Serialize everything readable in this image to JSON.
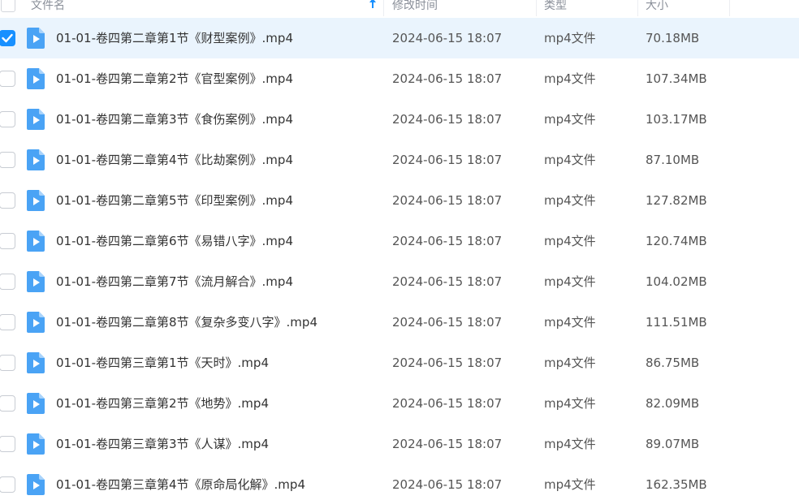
{
  "header": {
    "name_label": "文件名",
    "modified_label": "修改时间",
    "type_label": "类型",
    "size_label": "大小"
  },
  "files": [
    {
      "name": "01-01-卷四第二章第1节《财型案例》.mp4",
      "modified": "2024-06-15 18:07",
      "type": "mp4文件",
      "size": "70.18MB",
      "selected": true
    },
    {
      "name": "01-01-卷四第二章第2节《官型案例》.mp4",
      "modified": "2024-06-15 18:07",
      "type": "mp4文件",
      "size": "107.34MB",
      "selected": false
    },
    {
      "name": "01-01-卷四第二章第3节《食伤案例》.mp4",
      "modified": "2024-06-15 18:07",
      "type": "mp4文件",
      "size": "103.17MB",
      "selected": false
    },
    {
      "name": "01-01-卷四第二章第4节《比劫案例》.mp4",
      "modified": "2024-06-15 18:07",
      "type": "mp4文件",
      "size": "87.10MB",
      "selected": false
    },
    {
      "name": "01-01-卷四第二章第5节《印型案例》.mp4",
      "modified": "2024-06-15 18:07",
      "type": "mp4文件",
      "size": "127.82MB",
      "selected": false
    },
    {
      "name": "01-01-卷四第二章第6节《易错八字》.mp4",
      "modified": "2024-06-15 18:07",
      "type": "mp4文件",
      "size": "120.74MB",
      "selected": false
    },
    {
      "name": "01-01-卷四第二章第7节《流月解合》.mp4",
      "modified": "2024-06-15 18:07",
      "type": "mp4文件",
      "size": "104.02MB",
      "selected": false
    },
    {
      "name": "01-01-卷四第二章第8节《复杂多变八字》.mp4",
      "modified": "2024-06-15 18:07",
      "type": "mp4文件",
      "size": "111.51MB",
      "selected": false
    },
    {
      "name": "01-01-卷四第三章第1节《天时》.mp4",
      "modified": "2024-06-15 18:07",
      "type": "mp4文件",
      "size": "86.75MB",
      "selected": false
    },
    {
      "name": "01-01-卷四第三章第2节《地势》.mp4",
      "modified": "2024-06-15 18:07",
      "type": "mp4文件",
      "size": "82.09MB",
      "selected": false
    },
    {
      "name": "01-01-卷四第三章第3节《人谋》.mp4",
      "modified": "2024-06-15 18:07",
      "type": "mp4文件",
      "size": "89.07MB",
      "selected": false
    },
    {
      "name": "01-01-卷四第三章第4节《原命局化解》.mp4",
      "modified": "2024-06-15 18:07",
      "type": "mp4文件",
      "size": "162.35MB",
      "selected": false
    }
  ],
  "icons": {
    "file_icon": "video-file-icon",
    "sort_icon": "sort-ascending-icon",
    "check_icon": "checkmark-icon"
  },
  "colors": {
    "accent": "#1890ff",
    "selected_row": "#eaf4fd",
    "file_icon": "#4aa3f5"
  }
}
